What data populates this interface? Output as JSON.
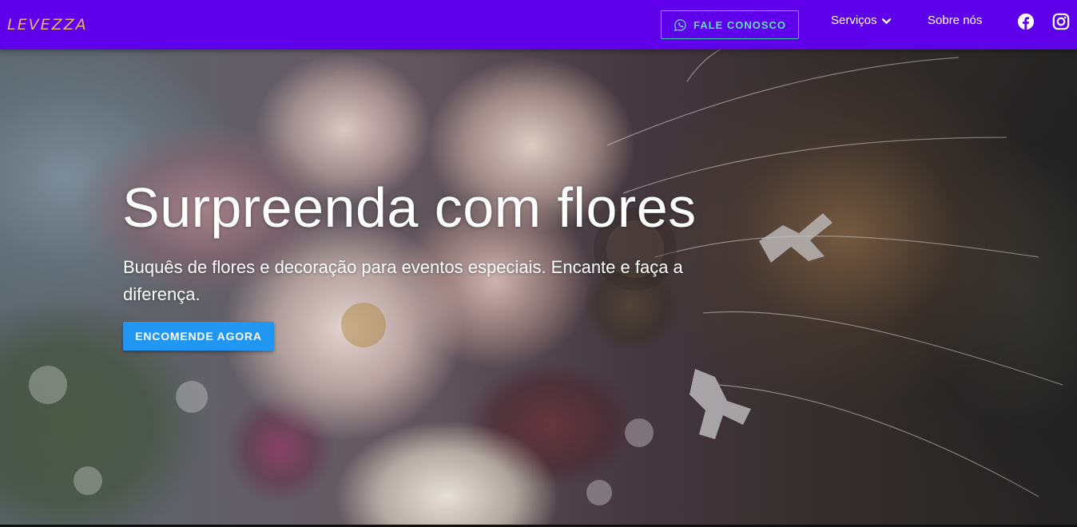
{
  "header": {
    "logo_text": "LEVEZZA",
    "contact_button": "FALE CONOSCO",
    "nav": {
      "servicos": "Serviços",
      "sobre": "Sobre nós"
    },
    "icons": {
      "whatsapp": "whatsapp-icon",
      "dropdown": "chevron-down-icon",
      "facebook": "facebook-icon",
      "instagram": "instagram-icon"
    }
  },
  "hero": {
    "title": "Surpreenda com flores",
    "subtitle": "Buquês de flores e decoração para eventos especiais. Encante e faça a diferença.",
    "cta": "ENCOMENDE AGORA"
  },
  "colors": {
    "navbar": "#5f00ea",
    "contact_accent": "#3fc7a6",
    "cta": "#2196f3",
    "logo": "#e9b26b"
  }
}
